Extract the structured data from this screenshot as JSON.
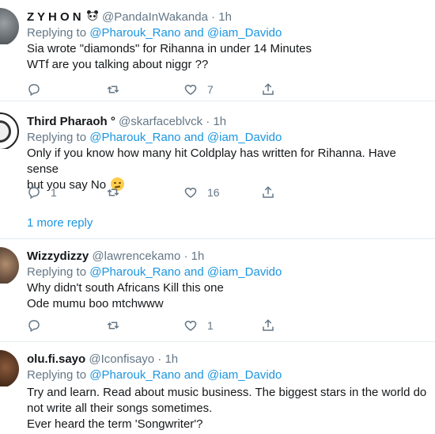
{
  "colors": {
    "link": "#1b95e0",
    "secondary": "#657786",
    "text": "#14171a",
    "border": "#e6ecf0"
  },
  "tweets": [
    {
      "name": "Z Y H O N",
      "name_emoji": "panda-icon",
      "handle": "@PandaInWakanda",
      "dot": "·",
      "time": "1h",
      "replying_prefix": "Replying to",
      "replying_user1": "@Pharouk_Rano",
      "replying_and": "and",
      "replying_user2": "@iam_Davido",
      "lines": [
        "Sia wrote \"diamonds\" for Rihanna in under 14 Minutes",
        "WTf are you talking about niggr ??"
      ],
      "reply_count": "",
      "retweet_count": "",
      "like_count": "7"
    },
    {
      "name": "Third Pharaoh °",
      "handle": "@skarfaceblvck",
      "dot": "·",
      "time": "1h",
      "replying_prefix": "Replying to",
      "replying_user1": "@Pharouk_Rano",
      "replying_and": "and",
      "replying_user2": "@iam_Davido",
      "lines": [
        "Only if you know how many hit Coldplay has written for Rihanna. Have sense",
        "but you say No"
      ],
      "line_emoji": "rolling-eyes-emoji",
      "reply_count": "1",
      "retweet_count": "",
      "like_count": "16",
      "more_replies": "1 more reply"
    },
    {
      "name": "Wizzydizzy",
      "handle": "@lawrencekamo",
      "dot": "·",
      "time": "1h",
      "replying_prefix": "Replying to",
      "replying_user1": "@Pharouk_Rano",
      "replying_and": "and",
      "replying_user2": "@iam_Davido",
      "lines": [
        "Why didn't south Africans Kill this one",
        "Ode mumu boo mtchwww"
      ],
      "reply_count": "",
      "retweet_count": "",
      "like_count": "1"
    },
    {
      "name": "olu.fi.sayo",
      "handle": "@Iconfisayo",
      "dot": "·",
      "time": "1h",
      "replying_prefix": "Replying to",
      "replying_user1": "@Pharouk_Rano",
      "replying_and": "and",
      "replying_user2": "@iam_Davido",
      "lines": [
        "Try and learn. Read about music business. The biggest stars in the world do",
        "not write all their songs sometimes.",
        "Ever heard the term 'Songwriter'?"
      ]
    }
  ]
}
